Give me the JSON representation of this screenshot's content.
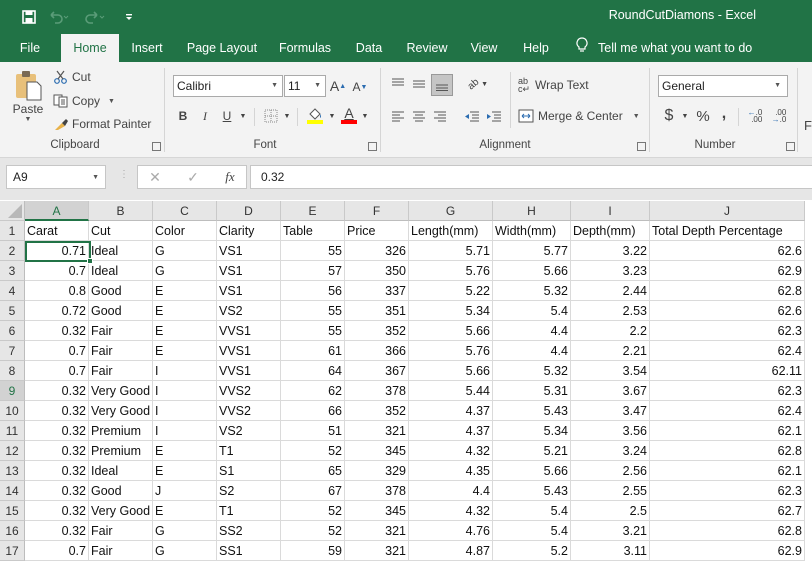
{
  "window": {
    "title": "RoundCutDiamons  -  Excel"
  },
  "qat": {
    "icons": [
      "save-icon",
      "undo-icon",
      "redo-icon",
      "customize-qat-icon"
    ]
  },
  "tabs": [
    {
      "label": "File"
    },
    {
      "label": "Home",
      "active": true
    },
    {
      "label": "Insert"
    },
    {
      "label": "Page Layout"
    },
    {
      "label": "Formulas"
    },
    {
      "label": "Data"
    },
    {
      "label": "Review"
    },
    {
      "label": "View"
    },
    {
      "label": "Help"
    }
  ],
  "tell_me": "Tell me what you want to do",
  "ribbon": {
    "clipboard": {
      "label": "Clipboard",
      "paste": "Paste",
      "cut": "Cut",
      "copy": "Copy",
      "format_painter": "Format Painter"
    },
    "font": {
      "label": "Font",
      "font_name": "Calibri",
      "font_size": "11",
      "bold": "B",
      "italic": "I",
      "underline": "U",
      "fill_color": "#ffff00",
      "font_color": "#ff0000"
    },
    "alignment": {
      "label": "Alignment",
      "wrap_text": "Wrap Text",
      "merge_center": "Merge & Center"
    },
    "number": {
      "label": "Number",
      "format": "General",
      "currency": "$",
      "percent": "%",
      "comma": ","
    }
  },
  "formula_bar": {
    "name_box": "A9",
    "fx": "fx",
    "value": "0.32"
  },
  "sheet": {
    "columns": [
      "A",
      "B",
      "C",
      "D",
      "E",
      "F",
      "G",
      "H",
      "I",
      "J"
    ],
    "selected_cell": "A9",
    "header_row": [
      "Carat",
      "Cut",
      "Color",
      "Clarity",
      "Table",
      "Price",
      "Length(mm)",
      "Width(mm)",
      "Depth(mm)",
      "Total Depth Percentage"
    ],
    "rows": [
      [
        "0.71",
        "Ideal",
        "G",
        "VS1",
        "55",
        "326",
        "5.71",
        "5.77",
        "3.22",
        "62.6"
      ],
      [
        "0.7",
        "Ideal",
        "G",
        "VS1",
        "57",
        "350",
        "5.76",
        "5.66",
        "3.23",
        "62.9"
      ],
      [
        "0.8",
        "Good",
        "E",
        "VS1",
        "56",
        "337",
        "5.22",
        "5.32",
        "2.44",
        "62.8"
      ],
      [
        "0.72",
        "Good",
        "E",
        "VS2",
        "55",
        "351",
        "5.34",
        "5.4",
        "2.53",
        "62.6"
      ],
      [
        "0.32",
        "Fair",
        "E",
        "VVS1",
        "55",
        "352",
        "5.66",
        "4.4",
        "2.2",
        "62.3"
      ],
      [
        "0.7",
        "Fair",
        "E",
        "VVS1",
        "61",
        "366",
        "5.76",
        "4.4",
        "2.21",
        "62.4"
      ],
      [
        "0.7",
        "Fair",
        "I",
        "VVS1",
        "64",
        "367",
        "5.66",
        "5.32",
        "3.54",
        "62.11"
      ],
      [
        "0.32",
        "Very Good",
        "I",
        "VVS2",
        "62",
        "378",
        "5.44",
        "5.31",
        "3.67",
        "62.3"
      ],
      [
        "0.32",
        "Very Good",
        "I",
        "VVS2",
        "66",
        "352",
        "4.37",
        "5.43",
        "3.47",
        "62.4"
      ],
      [
        "0.32",
        "Premium",
        "I",
        "VS2",
        "51",
        "321",
        "4.37",
        "5.34",
        "3.56",
        "62.1"
      ],
      [
        "0.32",
        "Premium",
        "E",
        "T1",
        "52",
        "345",
        "4.32",
        "5.21",
        "3.24",
        "62.8"
      ],
      [
        "0.32",
        "Ideal",
        "E",
        "S1",
        "65",
        "329",
        "4.35",
        "5.66",
        "2.56",
        "62.1"
      ],
      [
        "0.32",
        "Good",
        "J",
        "S2",
        "67",
        "378",
        "4.4",
        "5.43",
        "2.55",
        "62.3"
      ],
      [
        "0.32",
        "Very Good",
        "E",
        "T1",
        "52",
        "345",
        "4.32",
        "5.4",
        "2.5",
        "62.7"
      ],
      [
        "0.32",
        "Fair",
        "G",
        "SS2",
        "52",
        "321",
        "4.76",
        "5.4",
        "3.21",
        "62.8"
      ],
      [
        "0.7",
        "Fair",
        "G",
        "SS1",
        "59",
        "321",
        "4.87",
        "5.2",
        "3.11",
        "62.9"
      ]
    ]
  }
}
